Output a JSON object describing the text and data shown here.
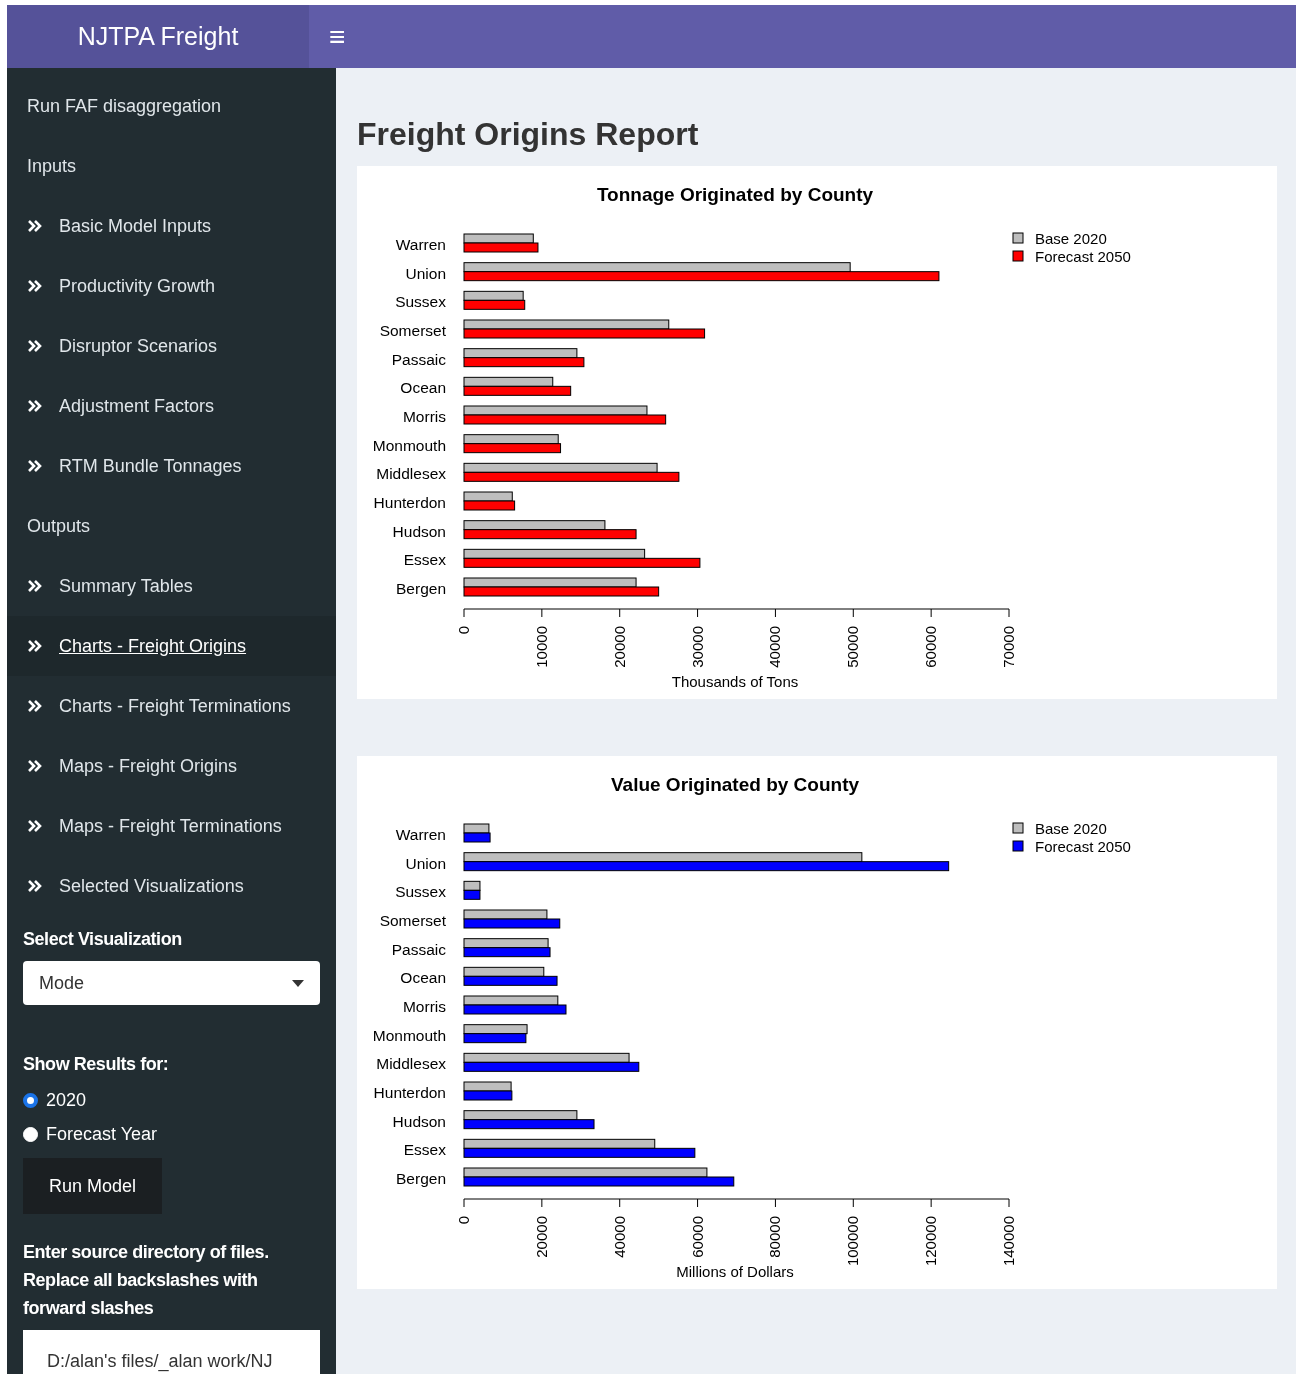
{
  "header": {
    "title": "NJTPA Freight",
    "menu_icon": "≡"
  },
  "sidebar": {
    "items": [
      {
        "kind": "section",
        "label": "Run FAF disaggregation",
        "selected": false
      },
      {
        "kind": "section",
        "label": "Inputs",
        "selected": false
      },
      {
        "kind": "link",
        "label": "Basic Model Inputs",
        "selected": false
      },
      {
        "kind": "link",
        "label": "Productivity Growth",
        "selected": false
      },
      {
        "kind": "link",
        "label": "Disruptor Scenarios",
        "selected": false
      },
      {
        "kind": "link",
        "label": "Adjustment Factors",
        "selected": false
      },
      {
        "kind": "link",
        "label": "RTM Bundle Tonnages",
        "selected": false
      },
      {
        "kind": "section",
        "label": "Outputs",
        "selected": false
      },
      {
        "kind": "link",
        "label": "Summary Tables",
        "selected": false
      },
      {
        "kind": "link",
        "label": "Charts - Freight Origins",
        "selected": true
      },
      {
        "kind": "link",
        "label": "Charts - Freight Terminations",
        "selected": false
      },
      {
        "kind": "link",
        "label": "Maps - Freight Origins",
        "selected": false
      },
      {
        "kind": "link",
        "label": "Maps - Freight Terminations",
        "selected": false
      },
      {
        "kind": "link",
        "label": "Selected Visualizations",
        "selected": false
      }
    ],
    "select": {
      "label": "Select Visualization",
      "value": "Mode"
    },
    "radio_group": {
      "label": "Show Results for:",
      "options": [
        {
          "label": "2020",
          "selected": true
        },
        {
          "label": "Forecast Year",
          "selected": false
        }
      ]
    },
    "run_button": "Run Model",
    "directory": {
      "label": "Enter source directory of files. Replace all backslashes with forward slashes",
      "value": "D:/alan's files/_alan work/NJ"
    }
  },
  "main": {
    "title": "Freight Origins Report",
    "charts": [
      {
        "chart_data": {
          "type": "bar",
          "orientation": "horizontal",
          "title": "Tonnage Originated by County",
          "xlabel": "Thousands of Tons",
          "categories": [
            "Warren",
            "Union",
            "Sussex",
            "Somerset",
            "Passaic",
            "Ocean",
            "Morris",
            "Monmouth",
            "Middlesex",
            "Hunterdon",
            "Hudson",
            "Essex",
            "Bergen"
          ],
          "series": [
            {
              "name": "Base 2020",
              "color": "#bebebe",
              "values": [
                8900,
                49600,
                7600,
                26300,
                14500,
                11400,
                23500,
                12100,
                24800,
                6200,
                18100,
                23200,
                22100
              ]
            },
            {
              "name": "Forecast 2050",
              "color": "#ff0000",
              "values": [
                9500,
                61000,
                7800,
                30900,
                15400,
                13700,
                25900,
                12400,
                27600,
                6500,
                22100,
                30300,
                25000
              ]
            }
          ],
          "legend": "topright",
          "xlim": [
            0,
            70000
          ],
          "xticks": [
            0,
            10000,
            20000,
            30000,
            40000,
            50000,
            60000,
            70000
          ]
        }
      },
      {
        "chart_data": {
          "type": "bar",
          "orientation": "horizontal",
          "title": "Value Originated by County",
          "xlabel": "Millions of Dollars",
          "categories": [
            "Warren",
            "Union",
            "Sussex",
            "Somerset",
            "Passaic",
            "Ocean",
            "Morris",
            "Monmouth",
            "Middlesex",
            "Hunterdon",
            "Hudson",
            "Essex",
            "Bergen"
          ],
          "series": [
            {
              "name": "Base 2020",
              "color": "#bebebe",
              "values": [
                6400,
                102200,
                4100,
                21300,
                21600,
                20500,
                24100,
                16200,
                42400,
                12100,
                29000,
                49000,
                62400
              ]
            },
            {
              "name": "Forecast 2050",
              "color": "#0000ff",
              "values": [
                6700,
                124500,
                4100,
                24600,
                22100,
                23900,
                26200,
                15900,
                44900,
                12300,
                33400,
                59300,
                69300
              ]
            }
          ],
          "legend": "topright",
          "xlim": [
            0,
            140000
          ],
          "xticks": [
            0,
            20000,
            40000,
            60000,
            80000,
            100000,
            120000,
            140000
          ]
        }
      }
    ]
  }
}
